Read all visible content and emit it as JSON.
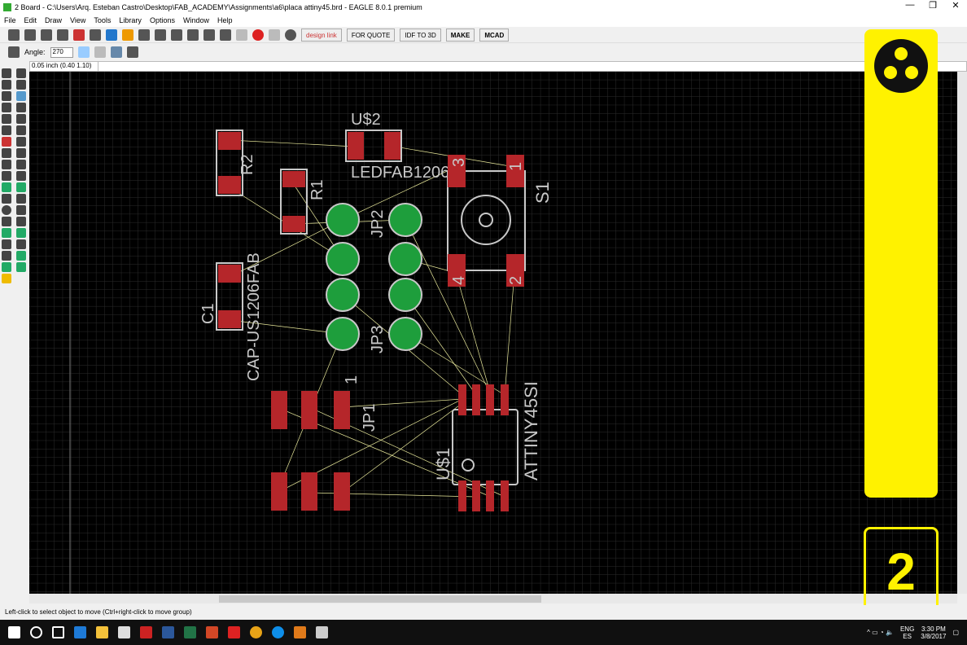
{
  "window": {
    "title": "2 Board - C:\\Users\\Arq. Esteban Castro\\Desktop\\FAB_ACADEMY\\Assignments\\a6\\placa attiny45.brd - EAGLE 8.0.1 premium",
    "controls": [
      "—",
      "❐",
      "✕"
    ]
  },
  "menu": [
    "File",
    "Edit",
    "Draw",
    "View",
    "Tools",
    "Library",
    "Options",
    "Window",
    "Help"
  ],
  "toolbar": {
    "buttons": [
      "design link",
      "FOR QUOTE",
      "IDF TO 3D",
      "MAKE",
      "MCAD"
    ]
  },
  "toolbar2": {
    "angle_label": "Angle:",
    "angle_value": "270"
  },
  "command": {
    "coord": "0.05 inch (0.40 1.10)",
    "value": ""
  },
  "board": {
    "labels": {
      "u2": "U$2",
      "u2_val": "LEDFAB1206",
      "r2": "R2",
      "r2_val": "CAP-US1206FAB",
      "r1": "R1",
      "c1": "C1",
      "jp2": "JP2",
      "jp3": "JP3",
      "s1": "S1",
      "jp1": "JP1",
      "jp1_pin": "1",
      "u1": "U$1",
      "u1_val": "ATTINY45SI",
      "s1_p3": "3",
      "s1_p1": "1",
      "s1_p4": "4",
      "s1_p2": "2"
    },
    "colors": {
      "pad": "#b5262a",
      "via": "#1e9e3c",
      "silk": "#c8c8c8",
      "airwire": "#e8e89a",
      "grid": "#2a2a2a"
    }
  },
  "status": {
    "hint": "Left-click to select object to move (Ctrl+right-click to move group)"
  },
  "overlay": {
    "number": "2",
    "color": "#fff200"
  },
  "tray": {
    "lang1": "ENG",
    "lang2": "ES",
    "time": "3:30 PM",
    "date": "3/8/2017"
  }
}
